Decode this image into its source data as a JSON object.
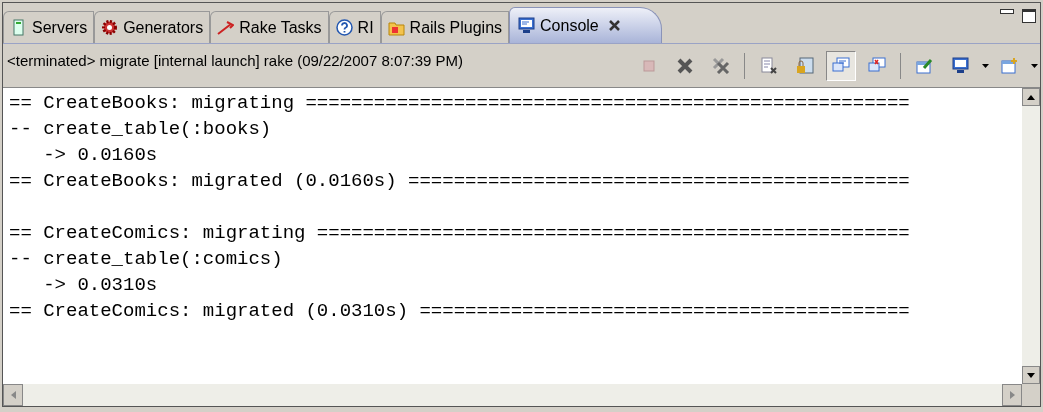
{
  "tabs": [
    {
      "label": "Servers",
      "kind": "servers",
      "selected": false
    },
    {
      "label": "Generators",
      "kind": "gear",
      "selected": false
    },
    {
      "label": "Rake Tasks",
      "kind": "rake",
      "selected": false
    },
    {
      "label": "RI",
      "kind": "help",
      "selected": false
    },
    {
      "label": "Rails Plugins",
      "kind": "plugin",
      "selected": false
    },
    {
      "label": "Console",
      "kind": "console",
      "selected": true,
      "closable": true
    }
  ],
  "console": {
    "status": "<terminated> migrate [internal launch] rake (09/22/2007 8:07:39 PM)",
    "toolbar": [
      {
        "kind": "stop",
        "pressed": false
      },
      {
        "kind": "remove",
        "pressed": false
      },
      {
        "kind": "remove-all",
        "pressed": false
      },
      {
        "kind": "sep"
      },
      {
        "kind": "clear",
        "pressed": false
      },
      {
        "kind": "lock",
        "pressed": false
      },
      {
        "kind": "show-out",
        "pressed": true
      },
      {
        "kind": "show-err",
        "pressed": false
      },
      {
        "kind": "sep"
      },
      {
        "kind": "pin",
        "pressed": false
      },
      {
        "kind": "display",
        "pressed": false,
        "menu": true
      },
      {
        "kind": "new",
        "pressed": false,
        "menu": true
      }
    ],
    "blocks": [
      [
        "== CreateBooks: migrating =====================================================",
        "-- create_table(:books)",
        "   -> 0.0160s",
        "== CreateBooks: migrated (0.0160s) ============================================"
      ],
      [
        "== CreateComics: migrating ====================================================",
        "-- create_table(:comics)",
        "   -> 0.0310s",
        "== CreateComics: migrated (0.0310s) ==========================================="
      ]
    ]
  }
}
